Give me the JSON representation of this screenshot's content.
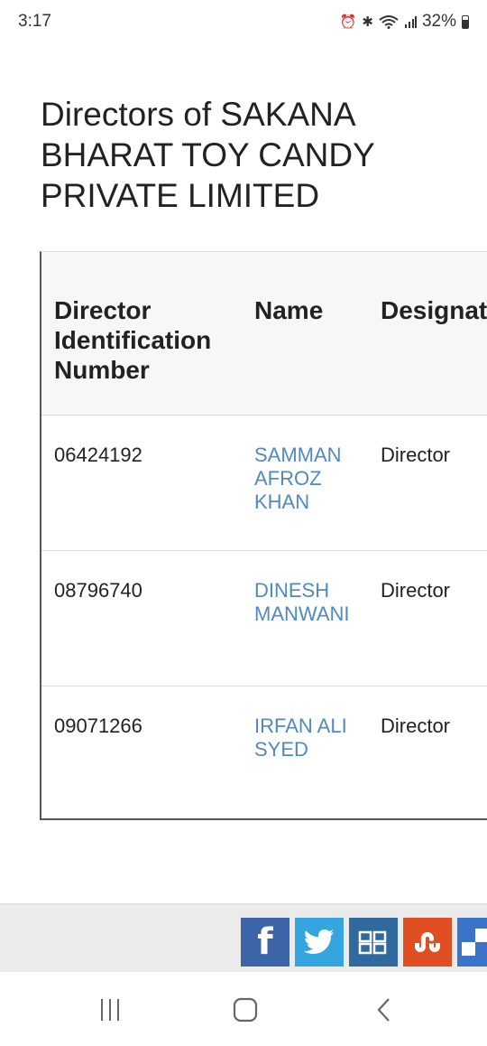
{
  "status_bar": {
    "time": "3:17",
    "battery": "32%",
    "icons": [
      "alarm-icon",
      "bluetooth-icon",
      "wifi-icon",
      "signal-icon",
      "battery-icon"
    ]
  },
  "page": {
    "title": "Directors of SAKANA BHARAT TOY CANDY PRIVATE LIMITED"
  },
  "table": {
    "headers": [
      "Director Identification Number",
      "Name",
      "Designatio"
    ],
    "rows": [
      {
        "din": "06424192",
        "name": "SAMMAN AFROZ KHAN",
        "designation": "Director"
      },
      {
        "din": "08796740",
        "name": "DINESH MANWANI",
        "designation": "Director"
      },
      {
        "din": "09071266",
        "name": "IRFAN ALI SYED",
        "designation": "Director"
      }
    ]
  },
  "share_bar": {
    "buttons": [
      "facebook-icon",
      "twitter-icon",
      "digg-icon",
      "stumbleupon-icon",
      "delicious-icon"
    ],
    "colors": {
      "facebook": "#3c64a8",
      "twitter": "#35a5e0",
      "digg": "#30699e",
      "stumbleupon": "#e04f23",
      "delicious": "#3a74c8"
    }
  },
  "nav_bar": {
    "buttons": [
      "recent-apps-icon",
      "home-icon",
      "back-icon"
    ]
  },
  "colors": {
    "link": "#4f8ac0",
    "header_bg": "#f7f7f7"
  }
}
